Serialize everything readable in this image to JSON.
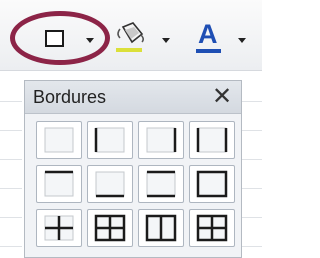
{
  "toolbar": {
    "borders_button": {
      "icon": "borders-icon",
      "has_dropdown": true,
      "highlighted": true
    },
    "fill_button": {
      "icon": "paint-bucket-icon",
      "has_dropdown": true
    },
    "font_color_button": {
      "icon": "font-color-icon",
      "glyph": "A",
      "has_dropdown": true
    }
  },
  "panel": {
    "title": "Bordures",
    "close_glyph": "✕",
    "accent_color": "#8c2447",
    "border_presets": [
      [
        "no-borders",
        "outer-left",
        "outer-right",
        "outer-left-right"
      ],
      [
        "outer-top",
        "outer-bottom",
        "outer-top-bottom",
        "outer-box"
      ],
      [
        "all-borders",
        "box-horizontal",
        "box-vertical",
        "box-all"
      ]
    ]
  }
}
